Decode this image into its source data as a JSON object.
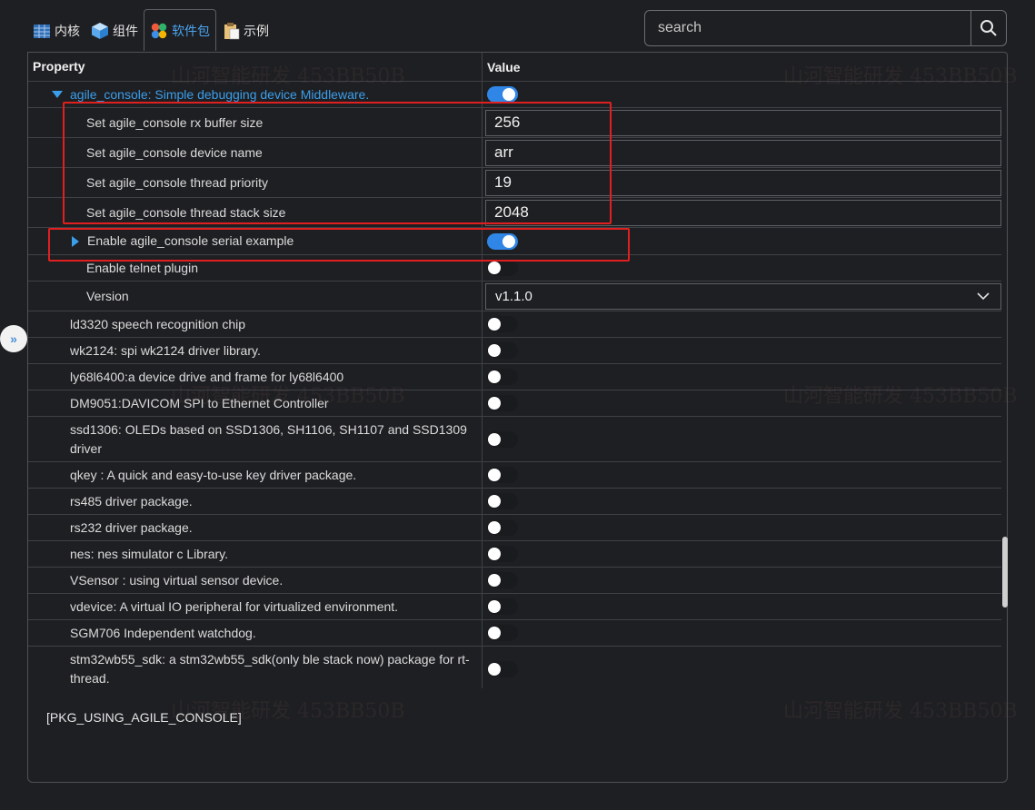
{
  "tabs": [
    {
      "label": "内核",
      "icon": "table-icon",
      "active": false
    },
    {
      "label": "组件",
      "icon": "cube-icon",
      "active": false
    },
    {
      "label": "软件包",
      "icon": "colored-dots-icon",
      "active": true
    },
    {
      "label": "示例",
      "icon": "clipboard-icon",
      "active": false
    }
  ],
  "search": {
    "placeholder": "search",
    "icon": "search-icon"
  },
  "table": {
    "header": {
      "property": "Property",
      "value": "Value"
    },
    "parent": {
      "label": "agile_console: Simple debugging device Middleware.",
      "enabled": true
    },
    "settings": [
      {
        "label": "Set agile_console rx buffer size",
        "value": "256"
      },
      {
        "label": "Set agile_console device name",
        "value": "arr"
      },
      {
        "label": "Set agile_console thread priority",
        "value": "19"
      },
      {
        "label": "Set agile_console thread stack size",
        "value": "2048"
      }
    ],
    "serial_example": {
      "label": "Enable agile_console serial example",
      "enabled": true
    },
    "telnet": {
      "label": "Enable telnet plugin",
      "enabled": false
    },
    "version": {
      "label": "Version",
      "value": "v1.1.0"
    },
    "packages": [
      {
        "label": "ld3320 speech recognition chip",
        "enabled": false
      },
      {
        "label": "wk2124: spi wk2124 driver library.",
        "enabled": false
      },
      {
        "label": "ly68l6400:a device drive and frame for ly68l6400",
        "enabled": false
      },
      {
        "label": "DM9051:DAVICOM SPI to Ethernet Controller",
        "enabled": false
      },
      {
        "label": "ssd1306: OLEDs based on SSD1306, SH1106, SH1107 and SSD1309 driver",
        "enabled": false
      },
      {
        "label": "qkey : A quick and easy-to-use key driver package.",
        "enabled": false
      },
      {
        "label": "rs485 driver package.",
        "enabled": false
      },
      {
        "label": "rs232 driver package.",
        "enabled": false
      },
      {
        "label": "nes: nes simulator c Library.",
        "enabled": false
      },
      {
        "label": "VSensor : using virtual sensor device.",
        "enabled": false
      },
      {
        "label": "vdevice: A virtual IO peripheral for virtualized environment.",
        "enabled": false
      },
      {
        "label": "SGM706 Independent watchdog.",
        "enabled": false
      },
      {
        "label": "stm32wb55_sdk: a stm32wb55_sdk(only ble stack now) package for rt-thread.",
        "enabled": false
      }
    ]
  },
  "description": "[PKG_USING_AGILE_CONSOLE]",
  "watermark": "山河智能研发 453BB50B",
  "colors": {
    "accent": "#2f86e6",
    "highlight_box": "#e02020",
    "background": "#1e1f22"
  }
}
